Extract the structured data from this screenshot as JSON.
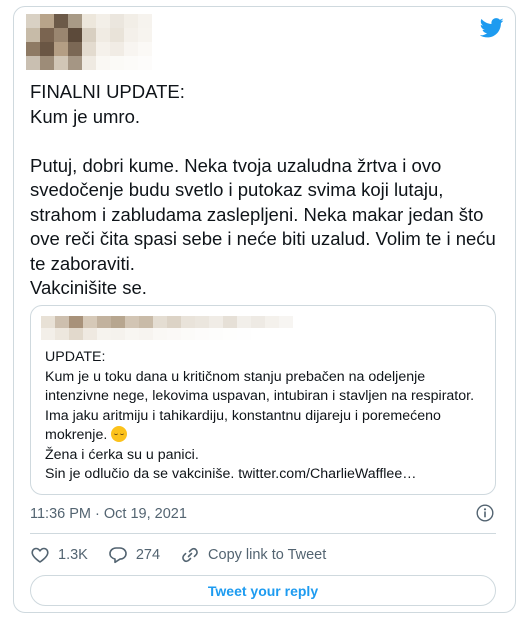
{
  "colors": {
    "accent": "#1d9bf0",
    "text": "#0f1419",
    "secondary": "#536471",
    "border": "#cfd9de"
  },
  "icons": {
    "brand": "twitter-bird-icon",
    "info": "info-icon",
    "like": "heart-icon",
    "reply": "speech-bubble-icon",
    "copy": "link-icon"
  },
  "tweet": {
    "heading": "FINALNI UPDATE:",
    "text": "Kum je umro.\n\nPutuj, dobri kume. Neka tvoja uzaludna žrtva i ovo svedočenje budu svetlo i putokaz svima koji lutaju, strahom i zabludama zaslepljeni. Neka makar jedan što ove reči čita spasi sebe i neće biti uzalud. Volim te i neću te zaboraviti.\nVakcinišite se.",
    "timestamp": "11:36 PM · Oct 19, 2021"
  },
  "quoted_tweet": {
    "text_before_emoji": "UPDATE:\nKum je u toku dana u kritičnom stanju prebačen na odeljenje intenzivne nege, lekovima uspavan, intubiran i stavljen na respirator. Ima jaku aritmiju i tahikardiju, konstantnu dijareju i poremećeno mokrenje. ",
    "text_after_emoji": "\nŽena i ćerka su u panici.\nSin je odlučio da se vakciniše. twitter.com/CharlieWafflee…"
  },
  "actions": {
    "likes": "1.3K",
    "replies": "274",
    "copy_link_label": "Copy link to Tweet"
  },
  "reply_button": {
    "label": "Tweet your reply"
  }
}
